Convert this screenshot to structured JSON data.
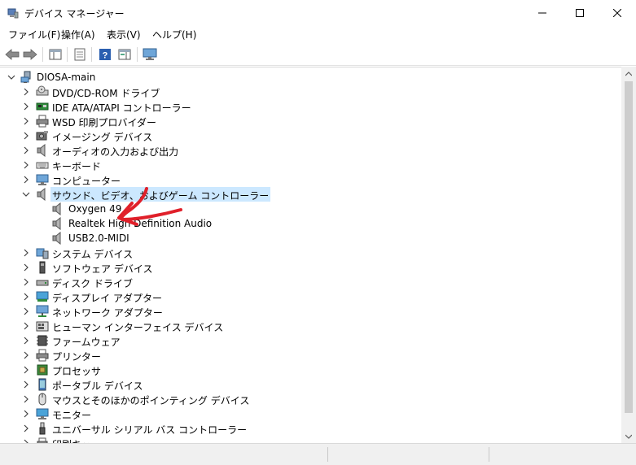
{
  "window": {
    "title": "デバイス マネージャー",
    "controls": [
      "minimize-icon",
      "maximize-icon",
      "close-icon"
    ]
  },
  "menu": {
    "file": "ファイル(F)",
    "action": "操作(A)",
    "view": "表示(V)",
    "help": "ヘルプ(H)"
  },
  "toolbar": {
    "buttons": [
      "back-arrow-icon",
      "forward-arrow-icon",
      "show-hide-console-tree-icon",
      "properties-icon",
      "help-icon",
      "action-pane-icon",
      "monitor-icon"
    ]
  },
  "tree": {
    "root": "DIOSA-main",
    "categories": [
      {
        "label": "DVD/CD-ROM ドライブ",
        "icon": "dvd-drive-icon"
      },
      {
        "label": "IDE ATA/ATAPI コントローラー",
        "icon": "ide-controller-icon"
      },
      {
        "label": "WSD 印刷プロバイダー",
        "icon": "printer-icon"
      },
      {
        "label": "イメージング デバイス",
        "icon": "camera-icon"
      },
      {
        "label": "オーディオの入力および出力",
        "icon": "speaker-icon"
      },
      {
        "label": "キーボード",
        "icon": "keyboard-icon"
      },
      {
        "label": "コンピューター",
        "icon": "computer-icon"
      },
      {
        "label": "サウンド、ビデオ、およびゲーム コントローラー",
        "icon": "speaker-icon",
        "expanded": true,
        "selected": true,
        "children": [
          "Oxygen 49",
          "Realtek High Definition Audio",
          "USB2.0-MIDI"
        ]
      },
      {
        "label": "システム デバイス",
        "icon": "system-device-icon"
      },
      {
        "label": "ソフトウェア デバイス",
        "icon": "software-device-icon"
      },
      {
        "label": "ディスク ドライブ",
        "icon": "disk-drive-icon"
      },
      {
        "label": "ディスプレイ アダプター",
        "icon": "display-adapter-icon"
      },
      {
        "label": "ネットワーク アダプター",
        "icon": "network-adapter-icon"
      },
      {
        "label": "ヒューマン インターフェイス デバイス",
        "icon": "hid-icon"
      },
      {
        "label": "ファームウェア",
        "icon": "firmware-icon"
      },
      {
        "label": "プリンター",
        "icon": "printer-icon"
      },
      {
        "label": "プロセッサ",
        "icon": "processor-icon"
      },
      {
        "label": "ポータブル デバイス",
        "icon": "portable-device-icon"
      },
      {
        "label": "マウスとそのほかのポインティング デバイス",
        "icon": "mouse-icon"
      },
      {
        "label": "モニター",
        "icon": "monitor-icon"
      },
      {
        "label": "ユニバーサル シリアル バス コントローラー",
        "icon": "usb-icon"
      },
      {
        "label": "印刷キュー",
        "icon": "print-queue-icon"
      }
    ]
  },
  "annotation": {
    "color": "#e0202a"
  }
}
